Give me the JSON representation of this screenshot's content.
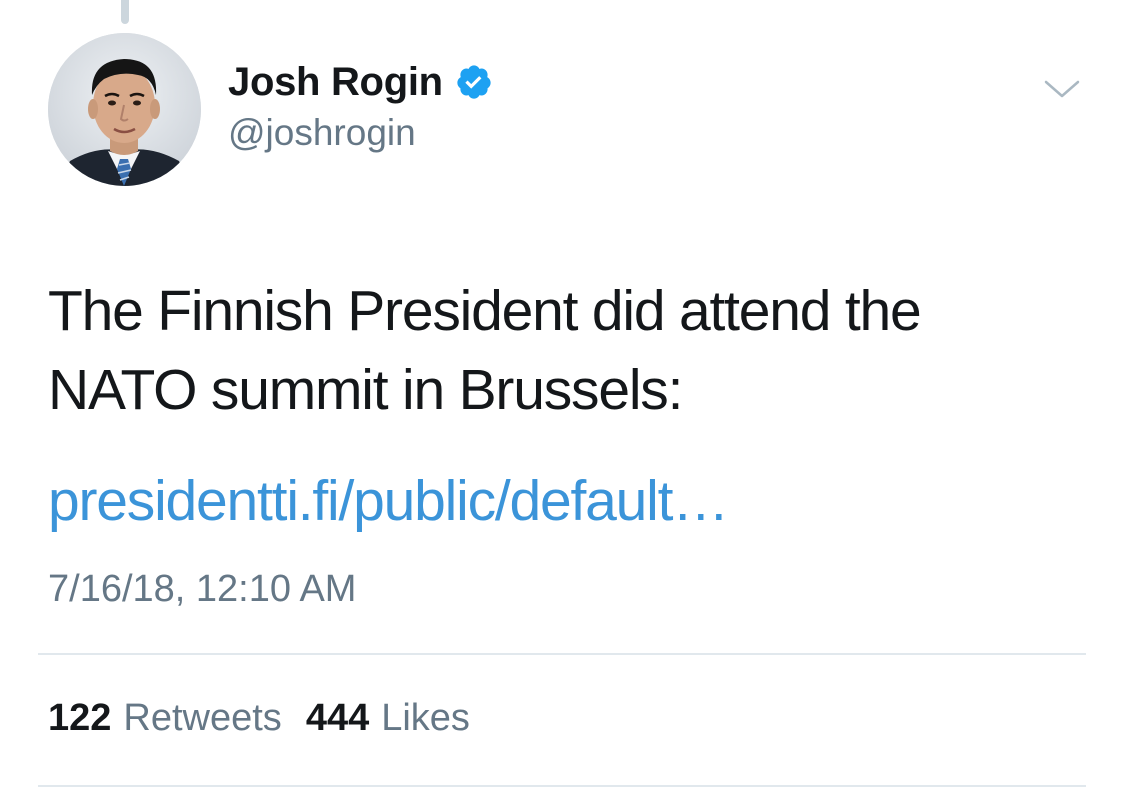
{
  "tweet": {
    "author": {
      "display_name": "Josh Rogin",
      "handle": "@joshrogin",
      "verified": true,
      "avatar_icon": "profile-photo"
    },
    "text_lines": [
      "The Finnish President did attend the",
      "NATO summit in Brussels:"
    ],
    "link_text": "presidentti.fi/public/default…",
    "timestamp": "7/16/18, 12:10 AM",
    "stats": {
      "retweets_count": "122",
      "retweets_label": "Retweets",
      "likes_count": "444",
      "likes_label": "Likes"
    },
    "menu_icon": "chevron-down-icon"
  },
  "colors": {
    "text_primary": "#14171a",
    "text_secondary": "#657786",
    "link": "#3b94d9",
    "verified_badge": "#1da1f2",
    "divider": "#e1e8ed"
  }
}
